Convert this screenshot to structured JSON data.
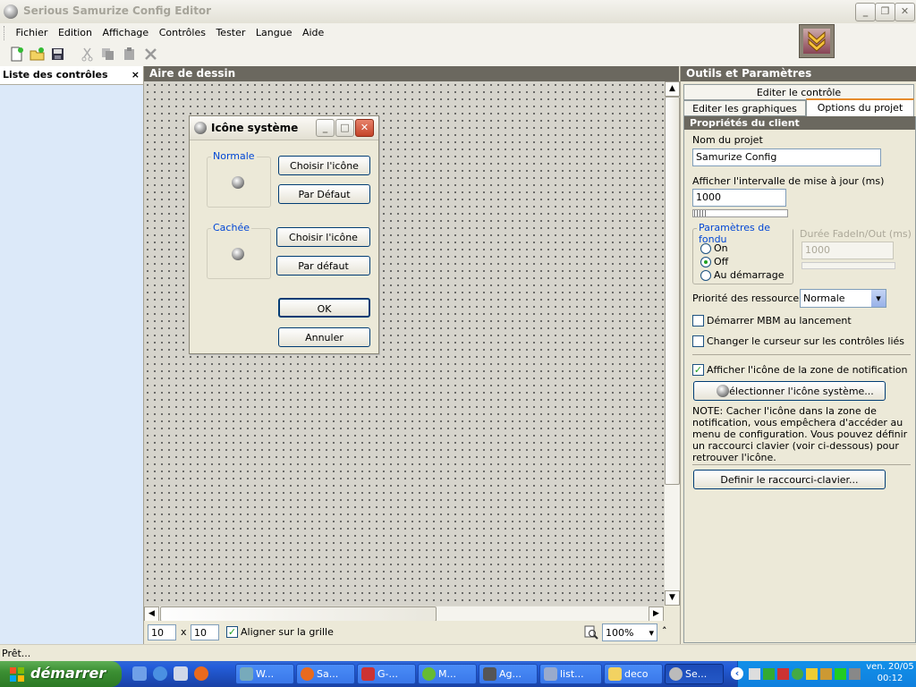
{
  "window": {
    "title": "Serious Samurize Config Editor"
  },
  "menu": [
    "Fichier",
    "Edition",
    "Affichage",
    "Contrôles",
    "Tester",
    "Langue",
    "Aide"
  ],
  "left_panel": {
    "title": "Liste des contrôles",
    "close": "×"
  },
  "canvas_panel": {
    "title": "Aire de dessin",
    "grid_x": "10",
    "grid_x_sep": "x",
    "grid_y": "10",
    "snap_label": "Aligner sur la grille",
    "snap_checked": true,
    "zoom": "100%"
  },
  "dialog": {
    "title": "Icône système",
    "group_normal": "Normale",
    "choose_icon_1": "Choisir l'icône",
    "default_1": "Par Défaut",
    "group_hidden": "Cachée",
    "choose_icon_2": "Choisir l'icône",
    "default_2": "Par défaut",
    "ok": "OK",
    "cancel": "Annuler"
  },
  "right_panel": {
    "title": "Outils et Paramètres",
    "tab_edit_control": "Editer le contrôle",
    "tab_edit_graphics": "Editer les graphiques",
    "tab_project_options": "Options du projet",
    "section_title": "Propriétés du client",
    "project_name_label": "Nom du projet",
    "project_name_value": "Samurize Config",
    "interval_label": "Afficher l'intervalle de mise à jour (ms)",
    "interval_value": "1000",
    "fade_group": "Paramètres de fondu",
    "fade_on": "On",
    "fade_off": "Off",
    "fade_startup": "Au démarrage",
    "fade_selected": "Off",
    "fade_duration_label": "Durée FadeIn/Out (ms)",
    "fade_duration_value": "1000",
    "priority_label": "Priorité des ressource:",
    "priority_value": "Normale",
    "start_mbm_label": "Démarrer MBM au lancement",
    "start_mbm_checked": false,
    "cursor_label": "Changer le curseur sur les contrôles liés",
    "cursor_checked": false,
    "show_tray_label": "Afficher l'icône de la zone de notification",
    "show_tray_checked": true,
    "select_icon_button": "Sélectionner l'icône système...",
    "note_line1": "NOTE: Cacher l'icône dans la zone de",
    "note_line2": "notification, vous empêchera d'accéder au",
    "note_line3": "menu de configuration. Vous pouvez définir",
    "note_line4": "un raccourci clavier (voir ci-dessous) pour",
    "note_line5": "retrouver l'icône.",
    "shortcut_button": "Definir le raccourci-clavier..."
  },
  "status": {
    "text": "Prêt..."
  },
  "taskbar": {
    "start": "démarrer",
    "tasks": [
      "W...",
      "Sa...",
      "G-...",
      "M...",
      "Ag...",
      "list...",
      "deco",
      "Se..."
    ],
    "clock_day": "ven. 20/05",
    "clock_time": "00:12"
  },
  "colors": {
    "accent": "#e68b2c",
    "panel_head": "#6b685f",
    "link_blue": "#0046d5",
    "taskbar": "#245edb",
    "start_green": "#3c8f33"
  }
}
